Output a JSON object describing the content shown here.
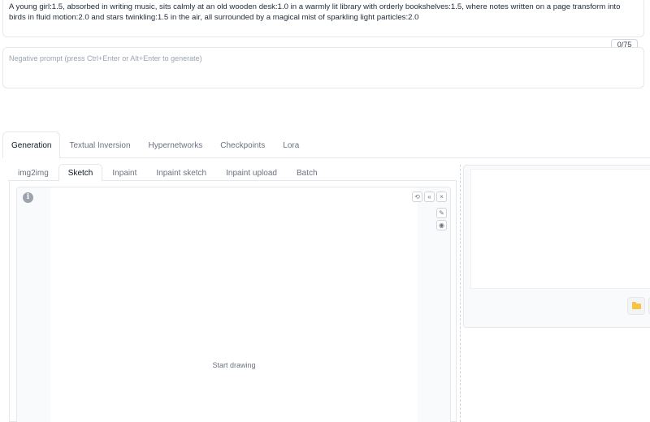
{
  "prompt": {
    "text": "A young girl:1.5, absorbed in writing music, sits calmly at an old wooden desk:1.0 in a warmly lit library with orderly bookshelves:1.5, where notes written on a page transform into birds in fluid motion:2.0 and stars twinkling:1.5 in the air, all surrounded by a magical mist of sparkling light particles:2.0",
    "token_count": "0/75"
  },
  "negative_prompt": {
    "placeholder": "Negative prompt (press Ctrl+Enter or Alt+Enter to generate)"
  },
  "main_tabs": [
    {
      "label": "Generation",
      "active": true
    },
    {
      "label": "Textual Inversion"
    },
    {
      "label": "Hypernetworks"
    },
    {
      "label": "Checkpoints"
    },
    {
      "label": "Lora"
    }
  ],
  "sub_tabs": [
    {
      "label": "img2img"
    },
    {
      "label": "Sketch",
      "active": true
    },
    {
      "label": "Inpaint"
    },
    {
      "label": "Inpaint sketch"
    },
    {
      "label": "Inpaint upload"
    },
    {
      "label": "Batch"
    }
  ],
  "sketch": {
    "empty_text": "Start drawing",
    "info_glyph": "i"
  },
  "icons": {
    "info": "info-icon",
    "undo": "undo-icon",
    "clear": "clear-icon",
    "close": "close-icon",
    "brush": "brush-icon",
    "color": "color-palette-icon",
    "folder": "folder-icon"
  },
  "colors": {
    "folder": "#f6c343",
    "border": "#e5e7eb"
  }
}
